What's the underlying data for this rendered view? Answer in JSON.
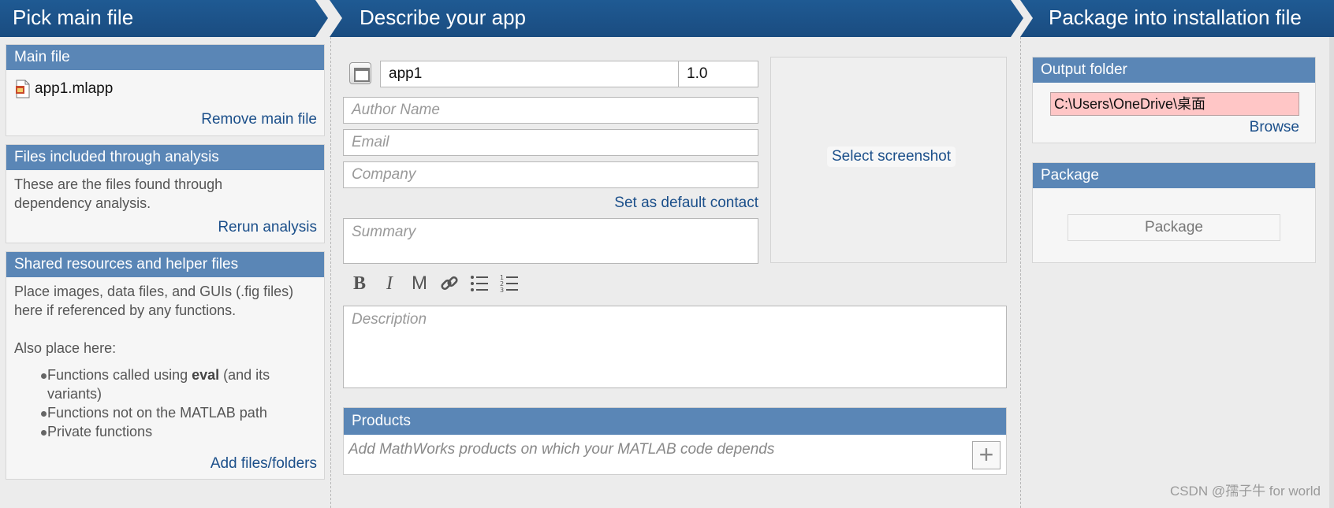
{
  "steps": {
    "pick": "Pick main file",
    "describe": "Describe your app",
    "package": "Package into installation file"
  },
  "main_file": {
    "header": "Main file",
    "file_name": "app1.mlapp",
    "remove_link": "Remove main file"
  },
  "analysis": {
    "header": "Files included through analysis",
    "text_line1": "These are the files found through",
    "text_line2": "dependency analysis.",
    "rerun_link": "Rerun analysis"
  },
  "shared": {
    "header": "Shared resources and helper files",
    "text_line1": "Place images, data files, and GUIs (.fig files)",
    "text_line2": "here if referenced by any functions.",
    "also": "Also place here:",
    "bullets": {
      "b1_pre": "Functions called using ",
      "b1_bold": "eval",
      "b1_post": " (and its",
      "b1_cont": "variants)",
      "b2": "Functions not on the MATLAB path",
      "b3": "Private functions"
    },
    "add_link": "Add files/folders"
  },
  "describe": {
    "app_name": "app1",
    "version": "1.0",
    "author_placeholder": "Author Name",
    "email_placeholder": "Email",
    "company_placeholder": "Company",
    "default_contact_link": "Set as default contact",
    "summary_placeholder": "Summary",
    "select_screenshot": "Select screenshot",
    "description_placeholder": "Description",
    "toolbar": {
      "bold": "B",
      "italic": "I",
      "monospace": "M",
      "link_icon": "link-icon",
      "bullet_icon": "bulleted-list-icon",
      "number_icon": "numbered-list-icon"
    }
  },
  "products": {
    "header": "Products",
    "text": "Add MathWorks products on which your MATLAB code depends"
  },
  "output": {
    "header": "Output folder",
    "path": "C:\\Users\\OneDrive\\桌面",
    "browse": "Browse"
  },
  "package": {
    "header": "Package",
    "button": "Package"
  },
  "watermark": "CSDN @孺子牛 for world",
  "colors": {
    "header_blue": "#1f5a93",
    "panel_head": "#5a86b6",
    "link": "#1b4f8a",
    "error_field": "#ffc6c6"
  }
}
